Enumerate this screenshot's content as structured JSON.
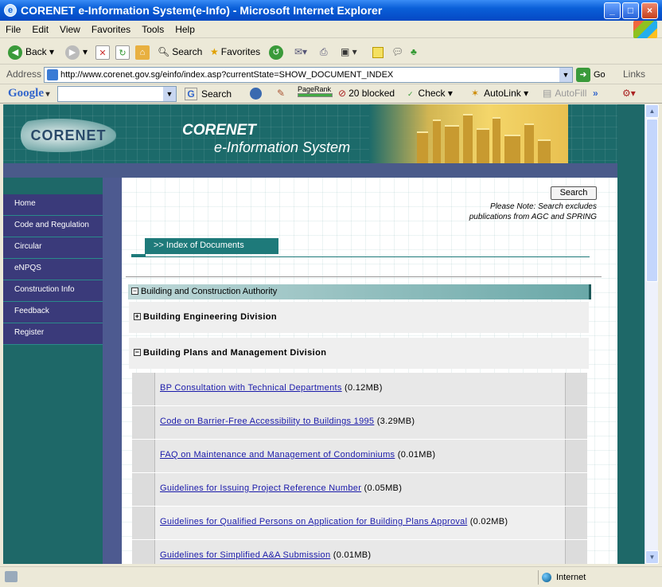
{
  "window": {
    "title": "CORENET e-Information System(e-Info) - Microsoft Internet Explorer"
  },
  "menu": [
    "File",
    "Edit",
    "View",
    "Favorites",
    "Tools",
    "Help"
  ],
  "toolbar": {
    "back": "Back",
    "search": "Search",
    "favorites": "Favorites"
  },
  "address": {
    "label": "Address",
    "url": "http://www.corenet.gov.sg/einfo/index.asp?currentState=SHOW_DOCUMENT_INDEX",
    "go": "Go",
    "links": "Links"
  },
  "googlebar": {
    "logo": "Google",
    "search": "Search",
    "pagerank": "PageRank",
    "blocked": "20 blocked",
    "check": "Check",
    "autolink": "AutoLink",
    "autofill": "AutoFill"
  },
  "banner": {
    "logo": "CORENET",
    "title1": "CORENET",
    "title2": "e-Information System"
  },
  "nav": [
    "Home",
    "Code and Regulation",
    "Circular",
    "eNPQS",
    "Construction Info",
    "Feedback",
    "Register"
  ],
  "content": {
    "search_button": "Search",
    "note_line1": "Please Note: Search excludes",
    "note_line2": "publications from AGC and SPRING",
    "index_tab": ">> Index of Documents",
    "authority": "Building and Construction Authority",
    "division1": "Building Engineering Division",
    "division2": "Building Plans and Management Division",
    "documents": [
      {
        "title": "BP Consultation with Technical Departments",
        "size": "(0.12MB)"
      },
      {
        "title": "Code on Barrier-Free Accessibility to Buildings 1995",
        "size": "(3.29MB)"
      },
      {
        "title": "FAQ on Maintenance and Management of Condominiums",
        "size": "(0.01MB)"
      },
      {
        "title": "Guidelines for Issuing Project Reference Number",
        "size": "(0.05MB)"
      },
      {
        "title": "Guidelines for Qualified Persons on Application for Building Plans Approval",
        "size": "(0.02MB)"
      },
      {
        "title": "Guidelines for Simplified A&A Submission",
        "size": "(0.01MB)"
      }
    ]
  },
  "status": {
    "zone": "Internet"
  },
  "colors": {
    "title_bar": "#0a5fd8",
    "banner_bg": "#1c6a6a",
    "nav_bg": "#3a3a7a",
    "link": "#1a1aaa"
  }
}
